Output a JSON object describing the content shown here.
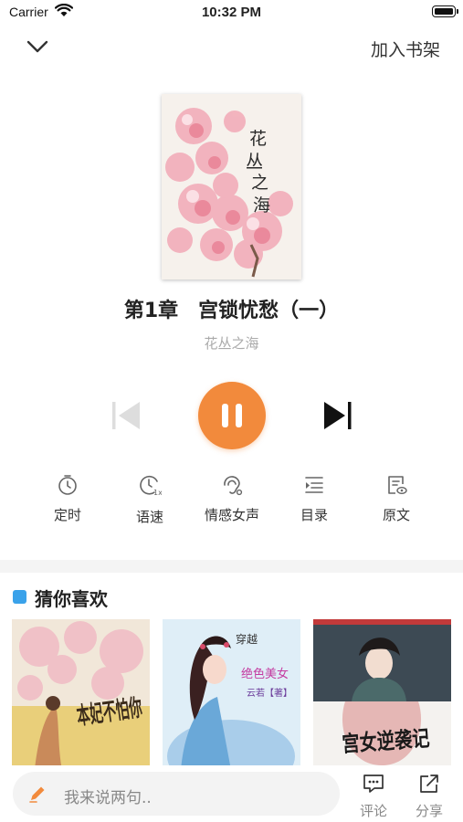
{
  "status_bar": {
    "carrier": "Carrier",
    "time": "10:32 PM"
  },
  "header": {
    "add_to_shelf": "加入书架",
    "collapse_icon": "chevron-down-icon"
  },
  "cover": {
    "title_lines": [
      "花",
      "丛",
      "之",
      "海"
    ]
  },
  "player": {
    "chapter_title": "第1章　宫锁忧愁（一）",
    "book_name": "花丛之海",
    "state": "playing",
    "accent_color": "#f28a3c"
  },
  "tools": [
    {
      "label": "定时",
      "icon": "timer-icon"
    },
    {
      "label": "语速",
      "icon": "speed-icon"
    },
    {
      "label": "情感女声",
      "icon": "voice-icon"
    },
    {
      "label": "目录",
      "icon": "catalog-icon"
    },
    {
      "label": "原文",
      "icon": "original-text-icon"
    }
  ],
  "recommend": {
    "title": "猜你喜欢",
    "books": [
      {
        "cover_text": "本妃不怕你"
      },
      {
        "cover_text": "穿越",
        "cover_subtext": "绝色美女",
        "cover_author": "云若【著】"
      },
      {
        "cover_text": "宫女逆袭记"
      }
    ]
  },
  "bottom_bar": {
    "comment_placeholder": "我来说两句..",
    "comment_label": "评论",
    "share_label": "分享"
  }
}
